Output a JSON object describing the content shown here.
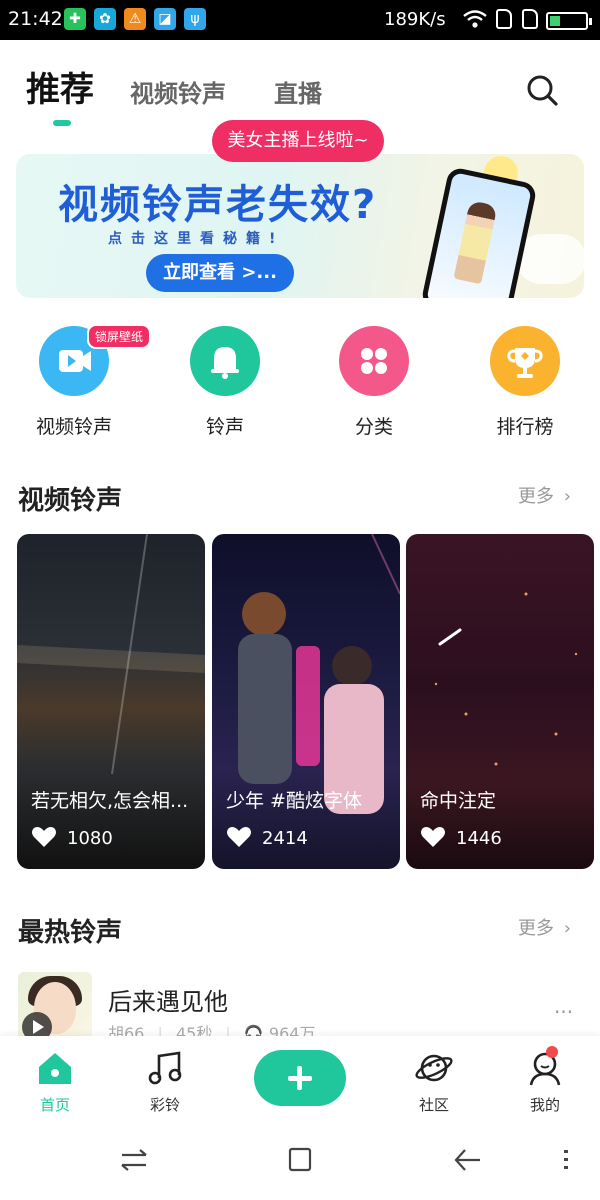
{
  "status_bar": {
    "time": "21:42",
    "speed": "189K/s",
    "icons": [
      "app-green-icon",
      "app-teal-icon",
      "warning-icon",
      "app-map-icon",
      "usb-icon",
      "wifi-icon",
      "signal-icon",
      "signal-icon",
      "battery-icon"
    ]
  },
  "top_tabs": {
    "active": "推荐",
    "tab2": "视频铃声",
    "tab3": "直播"
  },
  "banner": {
    "pill": "美女主播上线啦~",
    "title": "视频铃声老失效?",
    "subtitle": "点击这里看秘籍!",
    "button": "立即查看 >..."
  },
  "quick_entries": [
    {
      "label": "视频铃声",
      "badge": "锁屏壁纸",
      "color": "#3bb8f4",
      "icon": "video-play-icon"
    },
    {
      "label": "铃声",
      "color": "#20c79d",
      "icon": "bell-icon"
    },
    {
      "label": "分类",
      "color": "#f4588a",
      "icon": "grid-icon"
    },
    {
      "label": "排行榜",
      "color": "#fbb22f",
      "icon": "trophy-icon"
    }
  ],
  "video_section": {
    "title": "视频铃声",
    "more": "更多",
    "cards": [
      {
        "title": "若无相欠,怎会相...",
        "likes": "1080"
      },
      {
        "title": "少年 #酷炫字体",
        "likes": "2414"
      },
      {
        "title": "命中注定",
        "likes": "1446"
      }
    ]
  },
  "hot_section": {
    "title": "最热铃声",
    "more": "更多",
    "items": [
      {
        "title": "后来遇见他",
        "artist": "胡66",
        "duration": "45秒",
        "plays": "964万"
      }
    ]
  },
  "bottom_nav": {
    "home": "首页",
    "ring": "彩铃",
    "community": "社区",
    "mine": "我的",
    "accent": "#20c79d"
  }
}
